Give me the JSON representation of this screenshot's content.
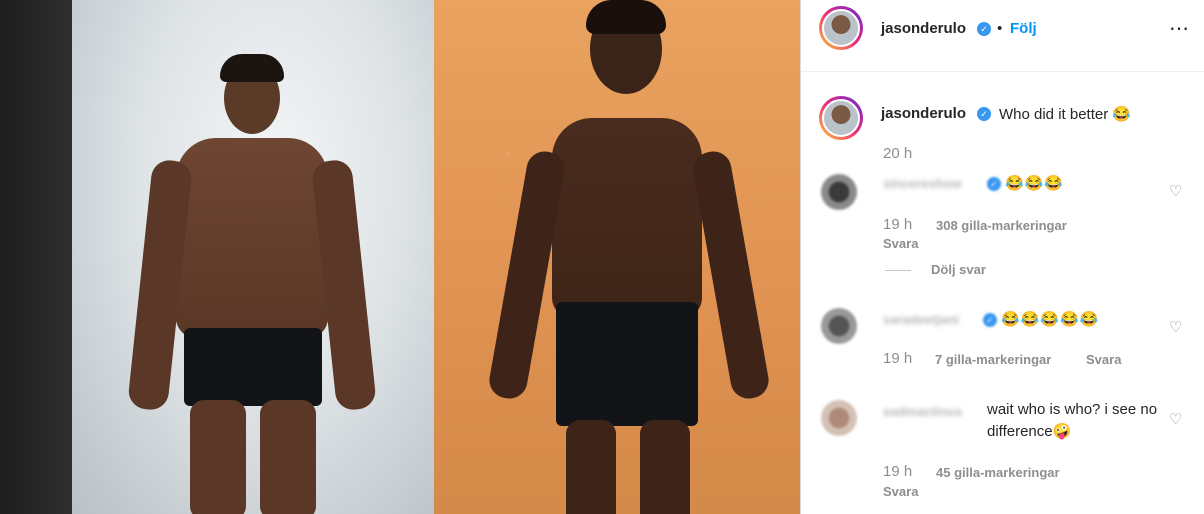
{
  "post": {
    "username": "jasonderulo",
    "follow_label": "Följ",
    "separator": "•",
    "more_icon": "⋯",
    "caption": "Who did it better 😂",
    "caption_time": "20 h"
  },
  "comments": [
    {
      "username_blurred": "sincereshow",
      "text": "😂😂😂",
      "time": "19 h",
      "likes": "308 gilla-markeringar",
      "reply": "Svara",
      "hide_replies": "Dölj svar"
    },
    {
      "username_blurred": "saradeetjani",
      "text": "😂😂😂😂😂",
      "time": "19 h",
      "likes": "7 gilla-markeringar",
      "reply": "Svara"
    },
    {
      "username_blurred": "sadmactinus",
      "text": "wait who is who? i see no difference🤪",
      "time": "19 h",
      "likes": "45 gilla-markeringar",
      "reply": "Svara"
    }
  ],
  "colors": {
    "accent": "#0095f6",
    "verified": "#3897f0",
    "text": "#262626",
    "muted": "#8e8e8e"
  },
  "icons": {
    "verified": "verified-badge-icon",
    "heart": "heart-icon",
    "more": "more-options-icon"
  }
}
